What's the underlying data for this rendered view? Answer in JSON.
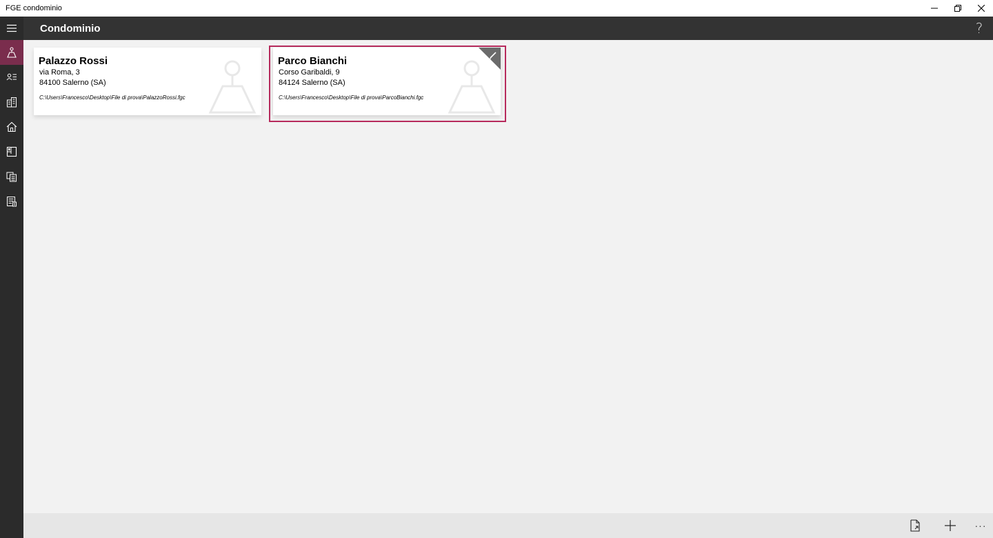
{
  "window": {
    "title": "FGE condominio"
  },
  "header": {
    "title": "Condominio",
    "help_label": "?"
  },
  "sidebar": {
    "items": [
      {
        "icon": "hamburger-menu-icon"
      },
      {
        "icon": "condominium-icon",
        "active": true
      },
      {
        "icon": "contacts-list-icon"
      },
      {
        "icon": "buildings-icon"
      },
      {
        "icon": "home-icon"
      },
      {
        "icon": "floor-plan-icon"
      },
      {
        "icon": "documents-icon"
      },
      {
        "icon": "report-icon"
      }
    ]
  },
  "cards": [
    {
      "name": "Palazzo Rossi",
      "address": "via Roma, 3",
      "city": "84100 Salerno (SA)",
      "path": "C:\\Users\\Francesco\\Desktop\\File di prova\\PalazzoRossi.fgc",
      "selected": false
    },
    {
      "name": "Parco Bianchi",
      "address": "Corso Garibaldi, 9",
      "city": "84124 Salerno (SA)",
      "path": "C:\\Users\\Francesco\\Desktop\\File di prova\\ParcoBianchi.fgc",
      "selected": true
    }
  ],
  "bottombar": {
    "more_label": "···"
  },
  "colors": {
    "accent": "#b72a5c",
    "sidebar_active": "#7a2d4d",
    "header_bg": "#333333",
    "sidebar_bg": "#2b2b2b"
  }
}
